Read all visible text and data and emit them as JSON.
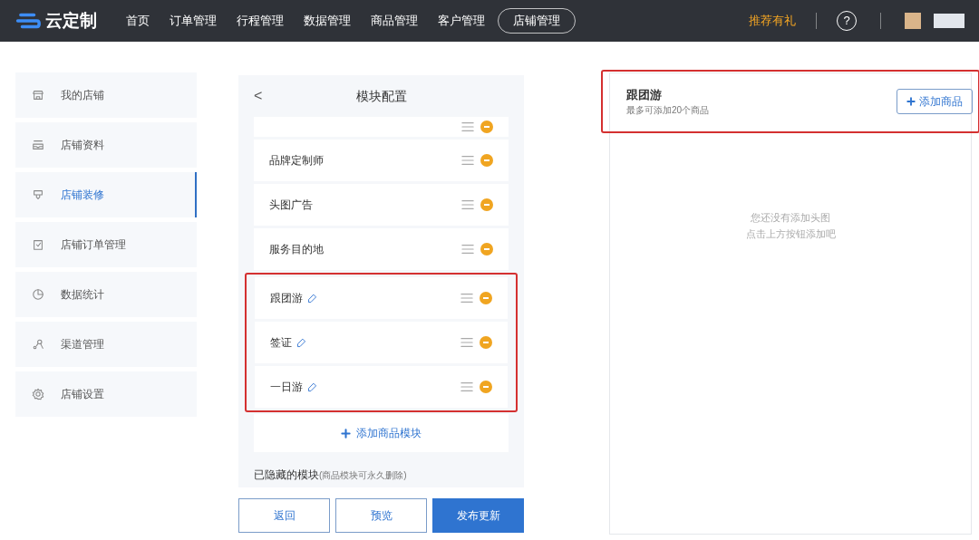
{
  "topbar": {
    "logo": "云定制",
    "nav": [
      {
        "label": "首页",
        "selected": false
      },
      {
        "label": "订单管理",
        "selected": false
      },
      {
        "label": "行程管理",
        "selected": false
      },
      {
        "label": "数据管理",
        "selected": false
      },
      {
        "label": "商品管理",
        "selected": false
      },
      {
        "label": "客户管理",
        "selected": false
      },
      {
        "label": "店铺管理",
        "selected": true
      }
    ],
    "promo": "推荐有礼",
    "help": "?"
  },
  "sidebar": {
    "items": [
      {
        "label": "我的店铺",
        "selected": false
      },
      {
        "label": "店铺资料",
        "selected": false
      },
      {
        "label": "店铺装修",
        "selected": true
      },
      {
        "label": "店铺订单管理",
        "selected": false
      },
      {
        "label": "数据统计",
        "selected": false
      },
      {
        "label": "渠道管理",
        "selected": false
      },
      {
        "label": "店铺设置",
        "selected": false
      }
    ]
  },
  "module_panel": {
    "title": "模块配置",
    "back": "<",
    "modules": [
      {
        "label": "品牌定制师",
        "editable": false,
        "highlighted": false
      },
      {
        "label": "头图广告",
        "editable": false,
        "highlighted": false
      },
      {
        "label": "服务目的地",
        "editable": false,
        "highlighted": false
      },
      {
        "label": "跟团游",
        "editable": true,
        "highlighted": true
      },
      {
        "label": "签证",
        "editable": true,
        "highlighted": true
      },
      {
        "label": "一日游",
        "editable": true,
        "highlighted": true
      }
    ],
    "add_module": "添加商品模块",
    "hidden_heading": "已隐藏的模块",
    "hidden_note": "(商品模块可永久删除)",
    "buttons": [
      {
        "label": "返回",
        "kind": "outline"
      },
      {
        "label": "预览",
        "kind": "outline"
      },
      {
        "label": "发布更新",
        "kind": "primary"
      }
    ]
  },
  "detail_panel": {
    "title": "跟团游",
    "subtitle": "最多可添加20个商品",
    "add_button": "添加商品",
    "highlighted": true,
    "empty": [
      "您还没有添加头图",
      "点击上方按钮添加吧"
    ]
  }
}
